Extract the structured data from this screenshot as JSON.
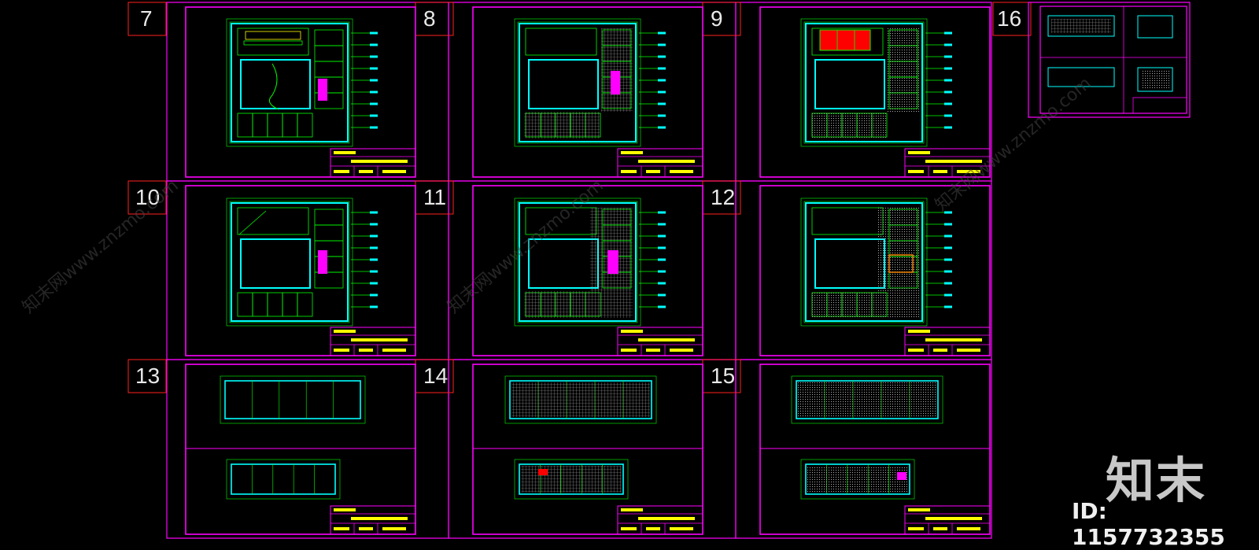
{
  "viewer": {
    "sheet_numbers": [
      "7",
      "8",
      "9",
      "10",
      "11",
      "12",
      "13",
      "14",
      "15",
      "16"
    ],
    "colors": {
      "background": "#000000",
      "sheet_frame": "#ff00ff",
      "inner_frame": "#ff00ff",
      "label_box": "#ff2020",
      "walls": "#00ff00",
      "glass": "#00ffff",
      "hatch": "#b0b0b0",
      "highlight": "#ff00ff",
      "red_block": "#ff0000",
      "orange_block": "#ff8800",
      "text": "#ffff00"
    }
  },
  "watermark": {
    "logo_text": "知末",
    "id_text": "ID: 1157732355",
    "diagonal_text": "知末网www.znzmo.com"
  }
}
